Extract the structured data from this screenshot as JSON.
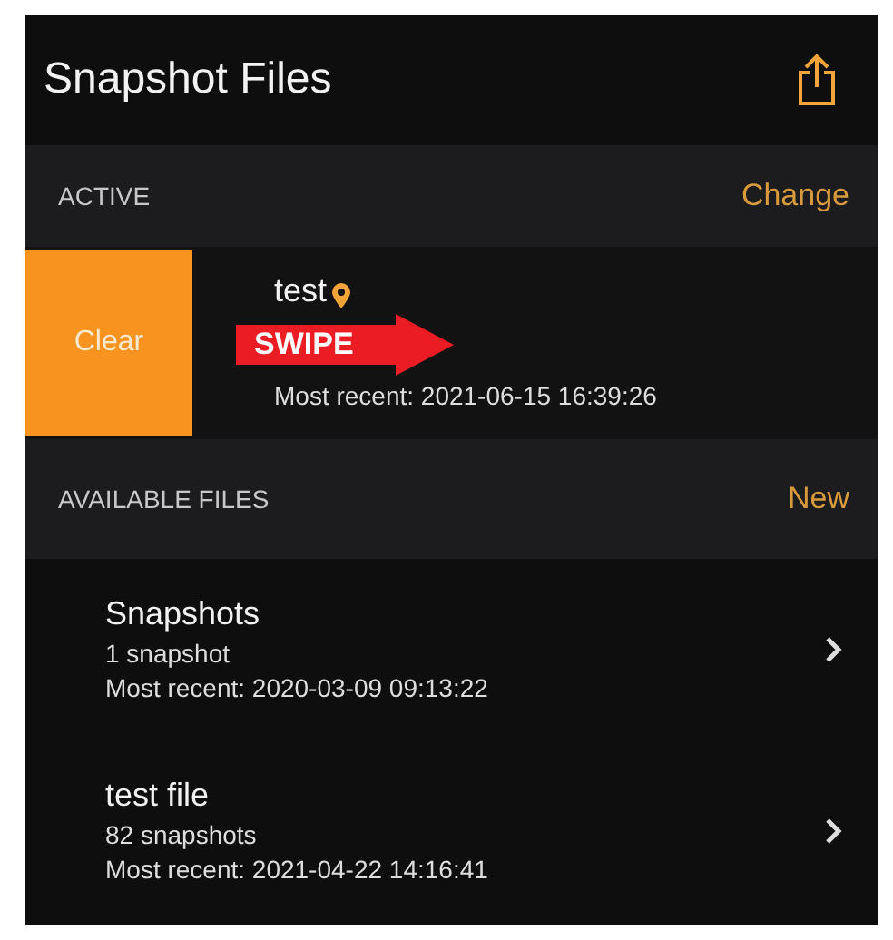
{
  "header": {
    "title": "Snapshot Files"
  },
  "active_section": {
    "label": "ACTIVE",
    "action": "Change"
  },
  "active_item": {
    "swipe_action": "Clear",
    "name": "test",
    "pinned": true,
    "subtitle": "Most recent: 2021-06-15 16:39:26"
  },
  "annotation": {
    "label": "SWIPE"
  },
  "available_section": {
    "label": "AVAILABLE FILES",
    "action": "New"
  },
  "files": [
    {
      "name": "Snapshots",
      "count": "1 snapshot",
      "recent": "Most recent: 2020-03-09 09:13:22"
    },
    {
      "name": "test file",
      "count": "82 snapshots",
      "recent": "Most recent: 2021-04-22 14:16:41"
    }
  ]
}
